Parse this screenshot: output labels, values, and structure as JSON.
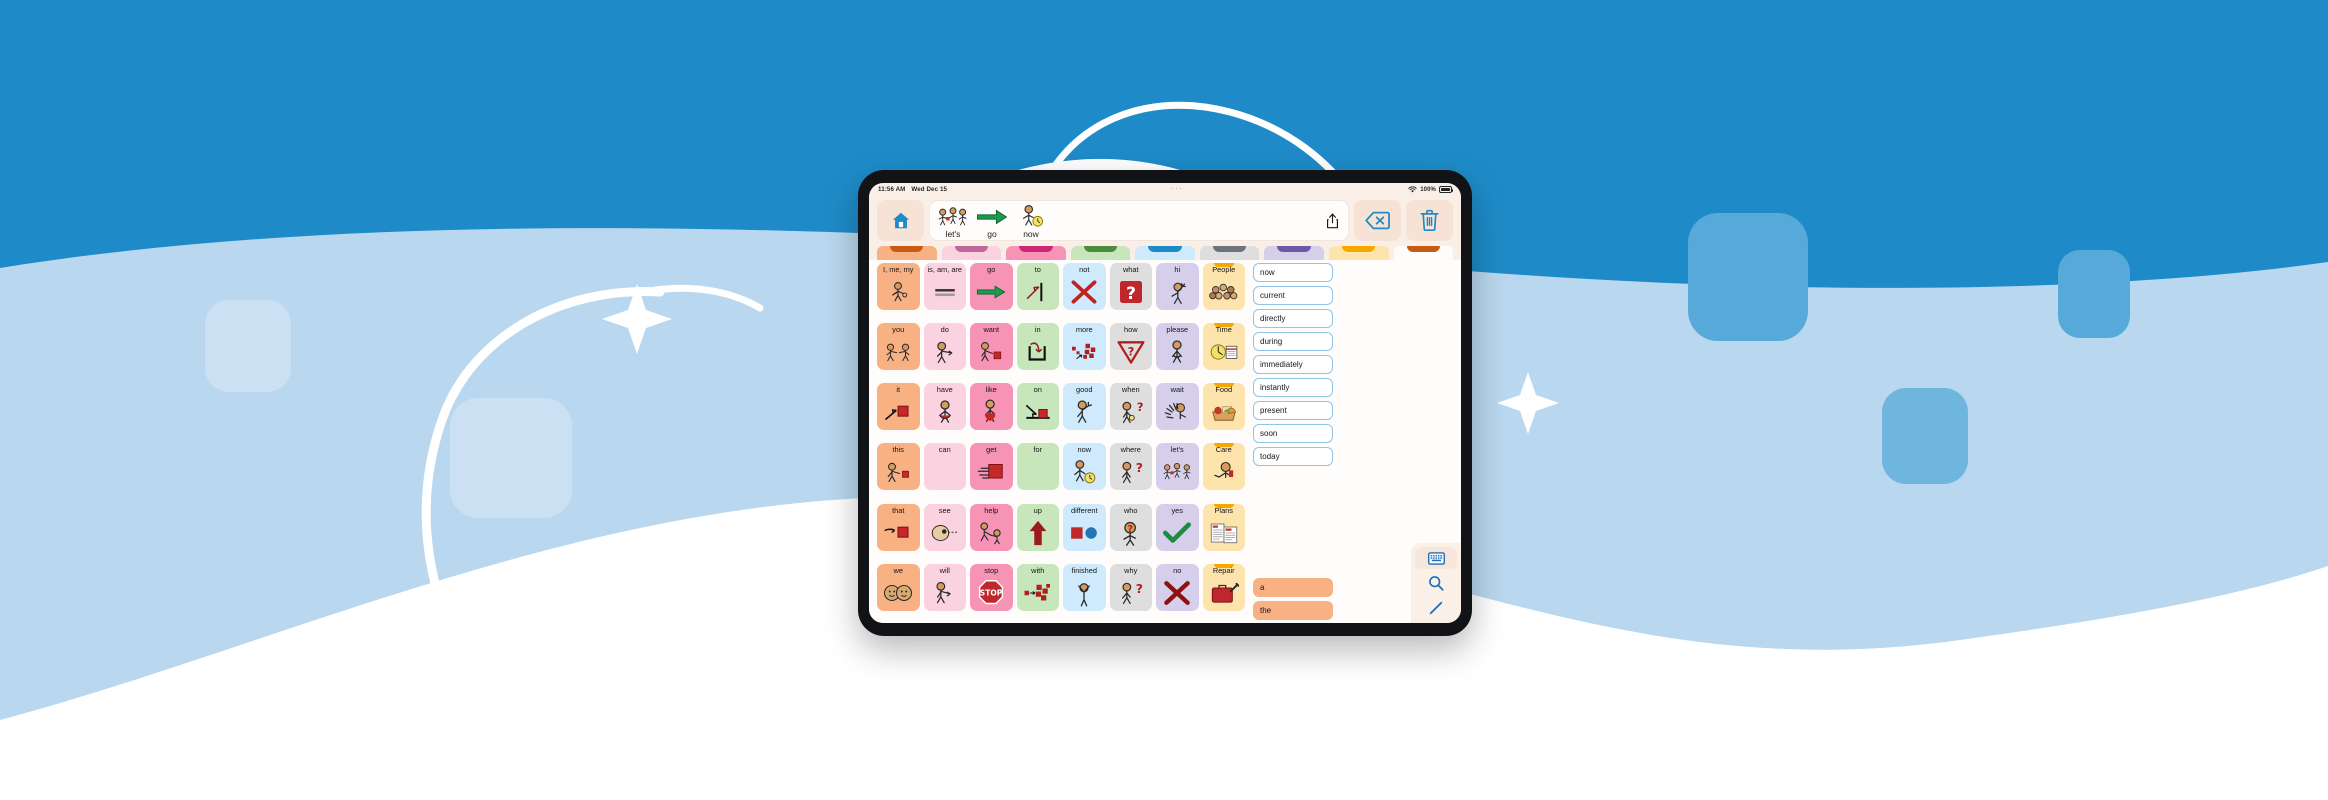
{
  "page": {
    "bg_color": "#1e8bc8",
    "band_color": "#b9d7ee",
    "wave_color": "#ffffff",
    "square_color": "#57a9da",
    "square_light_color": "#cbe0f2"
  },
  "device": {
    "bezel_color": "#111316",
    "screen_bg": "#faefe7"
  },
  "statusbar": {
    "time": "11:56 AM",
    "date": "Wed Dec 15",
    "handle": "···",
    "wifi_icon": "wifi-icon",
    "battery_pct": "100%",
    "battery_icon": "battery-full-icon"
  },
  "toolbar": {
    "home_label": "home-button",
    "home_icon": "home-icon",
    "share_icon": "share-icon",
    "backspace_icon": "backspace-icon",
    "trash_icon": "trash-icon",
    "accent": "#1e8bc8"
  },
  "sentence": {
    "words": [
      {
        "label": "let's",
        "icon": "people-greeting-icon"
      },
      {
        "label": "go",
        "icon": "green-arrow-icon"
      },
      {
        "label": "now",
        "icon": "person-clock-icon"
      }
    ]
  },
  "folder_tabs": [
    {
      "name": "pronouns-tab",
      "body": "#f7b183",
      "notch": "#c85a16"
    },
    {
      "name": "verbs-be-tab",
      "body": "#fbd2e0",
      "notch": "#c0689c"
    },
    {
      "name": "verbs-tab",
      "body": "#f793b4",
      "notch": "#cd2876"
    },
    {
      "name": "prepositions-tab",
      "body": "#c7e6bc",
      "notch": "#4c8c3f"
    },
    {
      "name": "describe-tab",
      "body": "#cfeafc",
      "notch": "#1e8bc8"
    },
    {
      "name": "questions-tab",
      "body": "#dededf",
      "notch": "#6c737c"
    },
    {
      "name": "social-tab",
      "body": "#d5cfeb",
      "notch": "#6a5ba9"
    },
    {
      "name": "categories-tab",
      "body": "#fde4ad",
      "notch": "#f5a800"
    },
    {
      "name": "extra-tab",
      "body": "#fdfcfb",
      "notch": "#c85a16"
    }
  ],
  "grid": {
    "columns": 8,
    "rows": 6,
    "cells": [
      {
        "label": "I, me, my",
        "bg": "#f7b183",
        "icon": "person-pointing-self-icon"
      },
      {
        "label": "is, am, are",
        "bg": "#fbd2e0",
        "icon": "equals-icon"
      },
      {
        "label": "go",
        "bg": "#f793b4",
        "icon": "green-arrow-icon"
      },
      {
        "label": "to",
        "bg": "#c7e6bc",
        "icon": "arrow-to-line-icon"
      },
      {
        "label": "not",
        "bg": "#cfeafc",
        "icon": "red-x-icon"
      },
      {
        "label": "what",
        "bg": "#dededf",
        "icon": "red-question-box-icon"
      },
      {
        "label": "hi",
        "bg": "#d5cfeb",
        "icon": "person-waving-icon"
      },
      {
        "label": "People",
        "bg": "#fde4ad",
        "icon": "group-of-people-icon",
        "folder": true
      },
      {
        "label": "you",
        "bg": "#f7b183",
        "icon": "two-people-pointing-icon"
      },
      {
        "label": "do",
        "bg": "#fbd2e0",
        "icon": "person-doing-icon"
      },
      {
        "label": "want",
        "bg": "#f793b4",
        "icon": "person-reaching-object-icon"
      },
      {
        "label": "in",
        "bg": "#c7e6bc",
        "icon": "arrow-into-container-icon"
      },
      {
        "label": "more",
        "bg": "#cfeafc",
        "icon": "more-blocks-icon"
      },
      {
        "label": "how",
        "bg": "#dededf",
        "icon": "yield-question-icon"
      },
      {
        "label": "please",
        "bg": "#d5cfeb",
        "icon": "person-please-icon"
      },
      {
        "label": "Time",
        "bg": "#fde4ad",
        "icon": "clock-calendar-icon",
        "folder": true
      },
      {
        "label": "it",
        "bg": "#f7b183",
        "icon": "hand-pointing-block-icon"
      },
      {
        "label": "have",
        "bg": "#fbd2e0",
        "icon": "person-holding-icon"
      },
      {
        "label": "like",
        "bg": "#f793b4",
        "icon": "person-heart-icon"
      },
      {
        "label": "on",
        "bg": "#c7e6bc",
        "icon": "arrow-onto-surface-icon"
      },
      {
        "label": "good",
        "bg": "#cfeafc",
        "icon": "person-thumbs-up-icon"
      },
      {
        "label": "when",
        "bg": "#dededf",
        "icon": "person-question-watch-icon"
      },
      {
        "label": "wait",
        "bg": "#d5cfeb",
        "icon": "hand-stop-icon"
      },
      {
        "label": "Food",
        "bg": "#fde4ad",
        "icon": "food-basket-icon",
        "folder": true
      },
      {
        "label": "this",
        "bg": "#f7b183",
        "icon": "person-pointing-block-icon"
      },
      {
        "label": "can",
        "bg": "#fbd2e0",
        "icon": "blank-icon"
      },
      {
        "label": "get",
        "bg": "#f793b4",
        "icon": "hand-grabbing-box-icon"
      },
      {
        "label": "for",
        "bg": "#c7e6bc",
        "icon": "blank-icon"
      },
      {
        "label": "now",
        "bg": "#cfeafc",
        "icon": "person-clock-icon"
      },
      {
        "label": "where",
        "bg": "#dededf",
        "icon": "person-question-where-icon"
      },
      {
        "label": "let's",
        "bg": "#d5cfeb",
        "icon": "people-greeting-icon"
      },
      {
        "label": "Care",
        "bg": "#fde4ad",
        "icon": "person-care-icon",
        "folder": true
      },
      {
        "label": "that",
        "bg": "#f7b183",
        "icon": "hand-pointing-far-icon"
      },
      {
        "label": "see",
        "bg": "#fbd2e0",
        "icon": "eye-looking-icon"
      },
      {
        "label": "help",
        "bg": "#f793b4",
        "icon": "person-helping-icon"
      },
      {
        "label": "up",
        "bg": "#c7e6bc",
        "icon": "up-arrow-icon"
      },
      {
        "label": "different",
        "bg": "#cfeafc",
        "icon": "square-circle-icon"
      },
      {
        "label": "who",
        "bg": "#dededf",
        "icon": "person-question-who-icon"
      },
      {
        "label": "yes",
        "bg": "#d5cfeb",
        "icon": "green-check-icon"
      },
      {
        "label": "Plans",
        "bg": "#fde4ad",
        "icon": "plan-papers-icon",
        "folder": true
      },
      {
        "label": "we",
        "bg": "#f7b183",
        "icon": "two-faces-icon"
      },
      {
        "label": "will",
        "bg": "#fbd2e0",
        "icon": "person-pointing-forward-icon"
      },
      {
        "label": "stop",
        "bg": "#f793b4",
        "icon": "stop-sign-icon"
      },
      {
        "label": "with",
        "bg": "#c7e6bc",
        "icon": "blocks-joining-icon"
      },
      {
        "label": "finished",
        "bg": "#cfeafc",
        "icon": "person-arms-up-icon"
      },
      {
        "label": "why",
        "bg": "#dededf",
        "icon": "person-question-why-icon"
      },
      {
        "label": "no",
        "bg": "#d5cfeb",
        "icon": "dark-red-x-icon"
      },
      {
        "label": "Repair",
        "bg": "#fde4ad",
        "icon": "repair-toolbox-icon",
        "folder": true
      }
    ]
  },
  "predictions": {
    "items": [
      "now",
      "current",
      "directly",
      "during",
      "immediately",
      "instantly",
      "present",
      "soon",
      "today"
    ],
    "quick_words": [
      "a",
      "the"
    ]
  },
  "rail": {
    "keyboard_icon": "keyboard-icon",
    "search_icon": "search-icon",
    "edit_icon": "pencil-icon"
  }
}
